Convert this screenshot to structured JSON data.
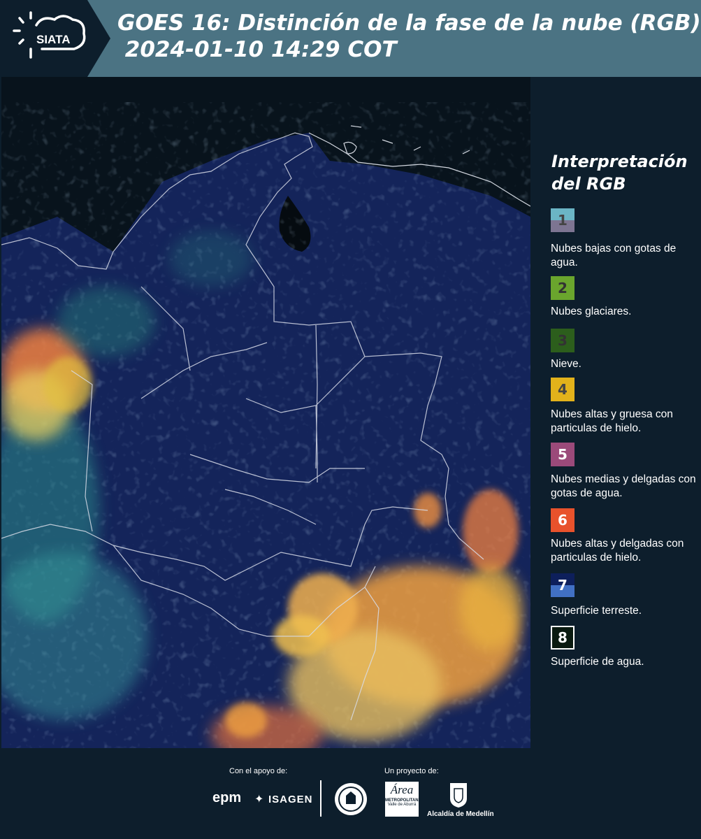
{
  "header": {
    "logo_text": "SIATA",
    "title_line1": "GOES 16: Distinción de la fase de la nube (RGB)",
    "title_line2": " 2024-01-10 14:29 COT"
  },
  "legend": {
    "title": "Interpretación del RGB",
    "items": [
      {
        "number": "1",
        "text": "Nubes bajas con gotas de agua.",
        "color_top": "#6bb5c5",
        "color_bottom": "#7d7592"
      },
      {
        "number": "2",
        "text": "Nubes glaciares.",
        "color": "#6aa52d"
      },
      {
        "number": "3",
        "text": "Nieve.",
        "color": "#2c5e1c"
      },
      {
        "number": "4",
        "text": "Nubes altas y gruesa con particulas de hielo.",
        "color": "#e2b21b"
      },
      {
        "number": "5",
        "text": "Nubes medias y delgadas con gotas de agua.",
        "color": "#9b4a7a"
      },
      {
        "number": "6",
        "text": "Nubes altas y delgadas con particulas de hielo.",
        "color": "#e8522c"
      },
      {
        "number": "7",
        "text": "Superficie terreste.",
        "color_top": "#0d1f5b",
        "color_bottom": "#4170c4"
      },
      {
        "number": "8",
        "text": "Superficie de agua.",
        "color": "#0a1a10"
      }
    ]
  },
  "footer": {
    "support_label": "Con el apoyo de:",
    "project_label": "Un proyecto de:",
    "epm": "epm",
    "isagen": "ISAGEN",
    "area_metro": "Área",
    "area_metro_sub": "METROPOLITANA",
    "area_metro_sub2": "Valle de Aburrá",
    "alcaldia": "Alcaldía de Medellín"
  },
  "colors": {
    "header_bg": "#4b7383",
    "page_bg": "#0d1e2c",
    "land": "#14245a",
    "ocean": "#071018",
    "cloud_orange": "#f0a040",
    "cloud_yellow": "#e8d060",
    "cloud_green": "#40c0a0"
  }
}
